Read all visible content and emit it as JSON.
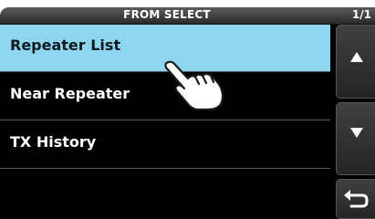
{
  "header": {
    "title": "FROM SELECT",
    "page_counter": "1/1"
  },
  "list": {
    "items": [
      {
        "label": "Repeater List",
        "selected": true
      },
      {
        "label": "Near Repeater",
        "selected": false
      },
      {
        "label": "TX History",
        "selected": false
      },
      {
        "label": "",
        "selected": false
      }
    ]
  },
  "side_buttons": {
    "up_icon": "triangle-up-icon",
    "down_icon": "triangle-down-icon",
    "back_icon": "return-arrow-icon"
  },
  "overlay": {
    "touch_icon": "pointing-hand-icon"
  },
  "colors": {
    "background": "#000000",
    "selected_row": "#8ed5ef",
    "text": "#ffffff",
    "selected_text": "#0f1a20"
  }
}
